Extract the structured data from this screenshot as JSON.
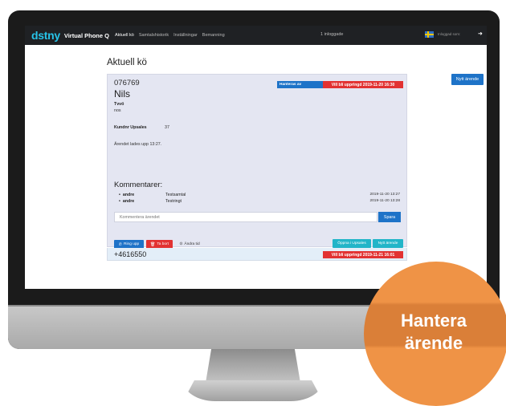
{
  "nav": {
    "brand": "dstny",
    "product": "Virtual Phone Q",
    "links": [
      "Aktuell kö",
      "Samtalshistorik",
      "Inställningar",
      "Bemanning"
    ],
    "online": "1 inloggade",
    "logged_in": "Inloggad som:"
  },
  "page": {
    "title": "Aktuell kö",
    "new_case": "Nytt ärende"
  },
  "card": {
    "number": "076769",
    "name": "Nils",
    "badge_handled": "Hanteras av",
    "badge_callback": "Vill bli uppringd 2019-11-20 16:30",
    "label_subject": "Tvvö",
    "subject_value": "nos",
    "customer_label": "Kundnr Upsales",
    "customer_value": "37",
    "added_text": "Ärendet lades upp 13:27.",
    "comments_title": "Kommentarer:",
    "comments": [
      {
        "who": "andre",
        "text": "Testsamtal",
        "date": "2019-11-20 13:27"
      },
      {
        "who": "andre",
        "text": "Testringt",
        "date": "2019-11-20 13:28"
      }
    ],
    "comment_placeholder": "Kommentera ärendet",
    "save": "Spara",
    "btn_call": "Ring upp",
    "btn_delete": "Ta bort",
    "btn_time": "Ändra tid",
    "btn_open": "Öppna i Upsales",
    "btn_new": "Nytt ärende"
  },
  "row2": {
    "number": "+4616550",
    "badge_callback": "Vill bli uppringd 2019-11-21 16:01"
  },
  "cta": {
    "line1": "Hantera",
    "line2": "ärende"
  },
  "colors": {
    "brand": "#27c3e8",
    "primary": "#1e73c8",
    "danger": "#e23232",
    "teal": "#22b5c8",
    "cta": "#ef9346"
  }
}
